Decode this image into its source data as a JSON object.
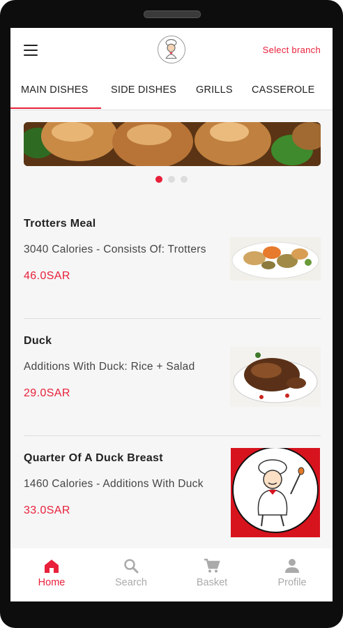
{
  "header": {
    "select_branch": "Select branch",
    "logo_icon": "chef-logo-icon",
    "menu_icon": "hamburger-menu-icon"
  },
  "tabs": [
    {
      "label": "MAIN DISHES",
      "active": true
    },
    {
      "label": "SIDE DISHES",
      "active": false
    },
    {
      "label": "GRILLS",
      "active": false
    },
    {
      "label": "CASSEROLE",
      "active": false
    }
  ],
  "carousel": {
    "pages": 3,
    "active_page": 1
  },
  "items": [
    {
      "name": "Trotters Meal",
      "description": "3040 Calories - Consists Of: Trotters",
      "price": "46.0SAR"
    },
    {
      "name": "Duck",
      "description": "Additions With Duck: Rice + Salad",
      "price": "29.0SAR"
    },
    {
      "name": "Quarter Of A Duck Breast",
      "description": "1460 Calories - Additions With Duck",
      "price": "33.0SAR"
    }
  ],
  "bottom_nav": [
    {
      "label": "Home",
      "icon": "home-icon",
      "active": true
    },
    {
      "label": "Search",
      "icon": "search-icon",
      "active": false
    },
    {
      "label": "Basket",
      "icon": "cart-icon",
      "active": false
    },
    {
      "label": "Profile",
      "icon": "person-icon",
      "active": false
    }
  ],
  "colors": {
    "accent": "#e8203a",
    "inactive": "#aaaaaa"
  }
}
